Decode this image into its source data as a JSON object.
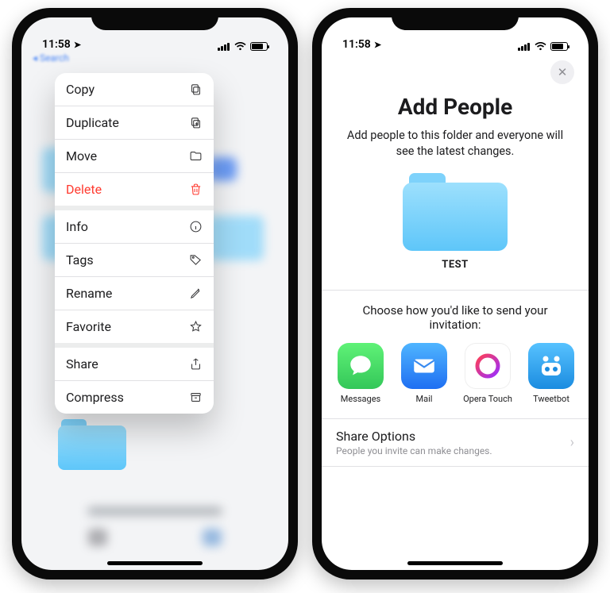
{
  "status": {
    "time": "11:58",
    "back_breadcrumb": "◂ Search"
  },
  "phone1": {
    "menu": [
      {
        "label": "Copy",
        "icon": "copy-icon",
        "danger": false,
        "sep": false
      },
      {
        "label": "Duplicate",
        "icon": "duplicate-icon",
        "danger": false,
        "sep": false
      },
      {
        "label": "Move",
        "icon": "folder-icon",
        "danger": false,
        "sep": false
      },
      {
        "label": "Delete",
        "icon": "trash-icon",
        "danger": true,
        "sep": true
      },
      {
        "label": "Info",
        "icon": "info-icon",
        "danger": false,
        "sep": false
      },
      {
        "label": "Tags",
        "icon": "tag-icon",
        "danger": false,
        "sep": false
      },
      {
        "label": "Rename",
        "icon": "pencil-icon",
        "danger": false,
        "sep": false
      },
      {
        "label": "Favorite",
        "icon": "star-icon",
        "danger": false,
        "sep": true
      },
      {
        "label": "Share",
        "icon": "share-icon",
        "danger": false,
        "sep": false
      },
      {
        "label": "Compress",
        "icon": "archive-icon",
        "danger": false,
        "sep": false
      }
    ]
  },
  "phone2": {
    "close": "✕",
    "title": "Add People",
    "subtitle": "Add people to this folder and everyone will see the latest changes.",
    "folder_name": "TEST",
    "invite_label": "Choose how you'd like to send your invitation:",
    "apps": [
      {
        "label": "Messages",
        "icon": "messages-icon"
      },
      {
        "label": "Mail",
        "icon": "mail-icon"
      },
      {
        "label": "Opera Touch",
        "icon": "opera-icon"
      },
      {
        "label": "Tweetbot",
        "icon": "tweetbot-icon"
      }
    ],
    "share_options": {
      "title": "Share Options",
      "subtitle": "People you invite can make changes."
    }
  }
}
